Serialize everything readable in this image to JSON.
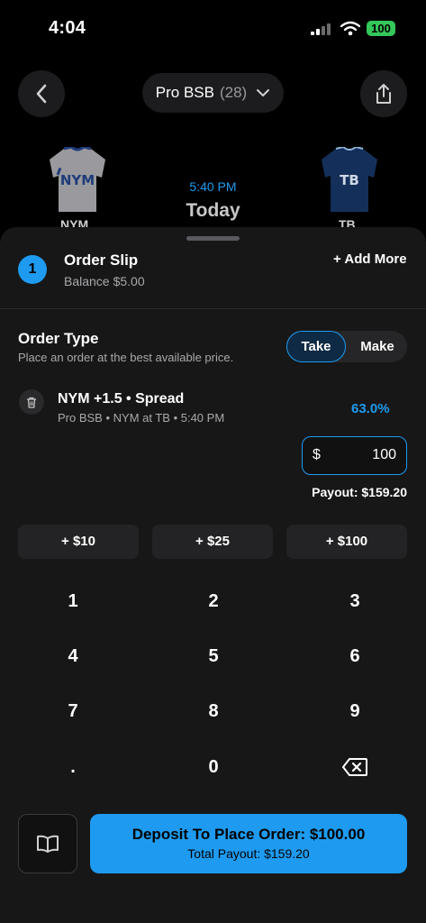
{
  "status_bar": {
    "time": "4:04",
    "battery": "100"
  },
  "header": {
    "league": "Pro BSB",
    "count": "(28)"
  },
  "matchup": {
    "home_team": "NYM",
    "away_team": "TB",
    "time": "5:40 PM",
    "day": "Today",
    "home_jersey_text": "NYM",
    "away_jersey_text": "TB"
  },
  "slip": {
    "step": "1",
    "title": "Order Slip",
    "balance_label": "Balance",
    "balance_value": "$5.00",
    "add_more": "+ Add More"
  },
  "order_type": {
    "title": "Order Type",
    "description": "Place an order at the best available price.",
    "options": [
      "Take",
      "Make"
    ],
    "selected": "Take"
  },
  "bet": {
    "title": "NYM +1.5 • Spread",
    "subtitle": "Pro BSB • NYM at TB • 5:40 PM",
    "percent": "63.0%",
    "currency": "$",
    "amount": "100",
    "payout": "Payout: $159.20"
  },
  "quick_add": [
    "+ $10",
    "+ $25",
    "+ $100"
  ],
  "keypad": [
    "1",
    "2",
    "3",
    "4",
    "5",
    "6",
    "7",
    "8",
    "9",
    ".",
    "0"
  ],
  "footer": {
    "button_main": "Deposit To Place Order: $100.00",
    "button_sub": "Total Payout: $159.20"
  },
  "colors": {
    "accent": "#1e9bf0",
    "battery": "#34c759",
    "sheet": "#171717"
  },
  "icons": [
    "back-chevron-icon",
    "chevron-down-icon",
    "share-icon",
    "trash-icon",
    "backspace-icon",
    "book-icon"
  ]
}
